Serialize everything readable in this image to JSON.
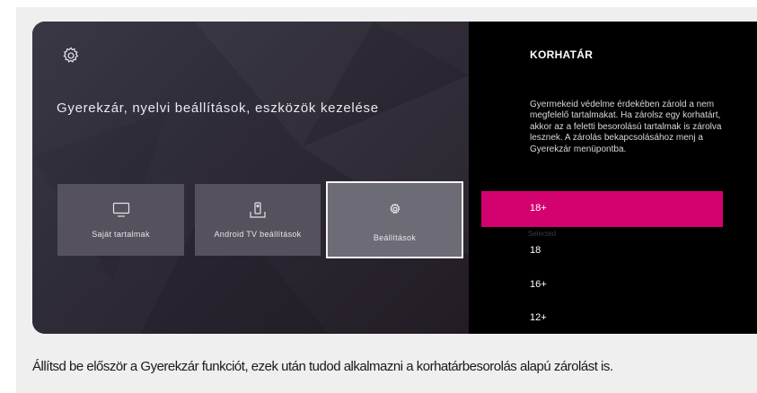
{
  "heading": "Gyerekzár, nyelvi beállítások, eszközök kezelése",
  "icons": {
    "top": "gear-icon",
    "card1": "tv-monitor-icon",
    "card2": "android-tv-remote-icon",
    "card3": "gear-icon"
  },
  "cards": [
    {
      "label": "Saját tartalmak",
      "selected": false
    },
    {
      "label": "Android TV beállítások",
      "selected": false
    },
    {
      "label": "Beállítások",
      "selected": true
    }
  ],
  "panel": {
    "title": "KORHATÁR",
    "description": "Gyermekeid védelme érdekében zárold a nem megfelelő tartalmakat. Ha zárolsz egy korhatárt, akkor az a feletti besorolású tartalmak is zárolva lesznek. A zárolás bekapcsolásához menj a Gyerekzár menüpontba.",
    "options": [
      {
        "label": "18+",
        "active": true
      },
      {
        "label": "18",
        "active": false,
        "overlay": "Selected"
      },
      {
        "label": "16+",
        "active": false
      },
      {
        "label": "12+",
        "active": false
      }
    ]
  },
  "caption": "Állítsd be először a Gyerekzár funkciót, ezek után tudod alkalmazni a korhatárbesorolás alapú zárolást is.",
  "colors": {
    "accent": "#d4026e",
    "panel_bg": "#000000",
    "frame_bg": "#efefef"
  }
}
